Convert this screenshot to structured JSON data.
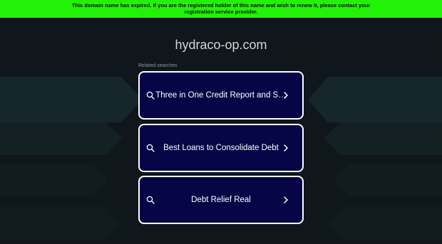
{
  "banner": {
    "text": "This domain name has expired. If you are the registered holder of this name and wish to renew it, please contact your registration service provider."
  },
  "domain": "hydraco-op.com",
  "related_label": "Related searches",
  "results": [
    {
      "label": "Three in One Credit Report and S…",
      "icon": "search-icon"
    },
    {
      "label": "Best Loans to Consolidate Debt",
      "icon": "search-icon"
    },
    {
      "label": "Debt Relief Real",
      "icon": "search-icon"
    }
  ],
  "colors": {
    "banner": "#22f207",
    "background": "#0f171c",
    "card": "#060646",
    "card_border": "#ffffff"
  }
}
